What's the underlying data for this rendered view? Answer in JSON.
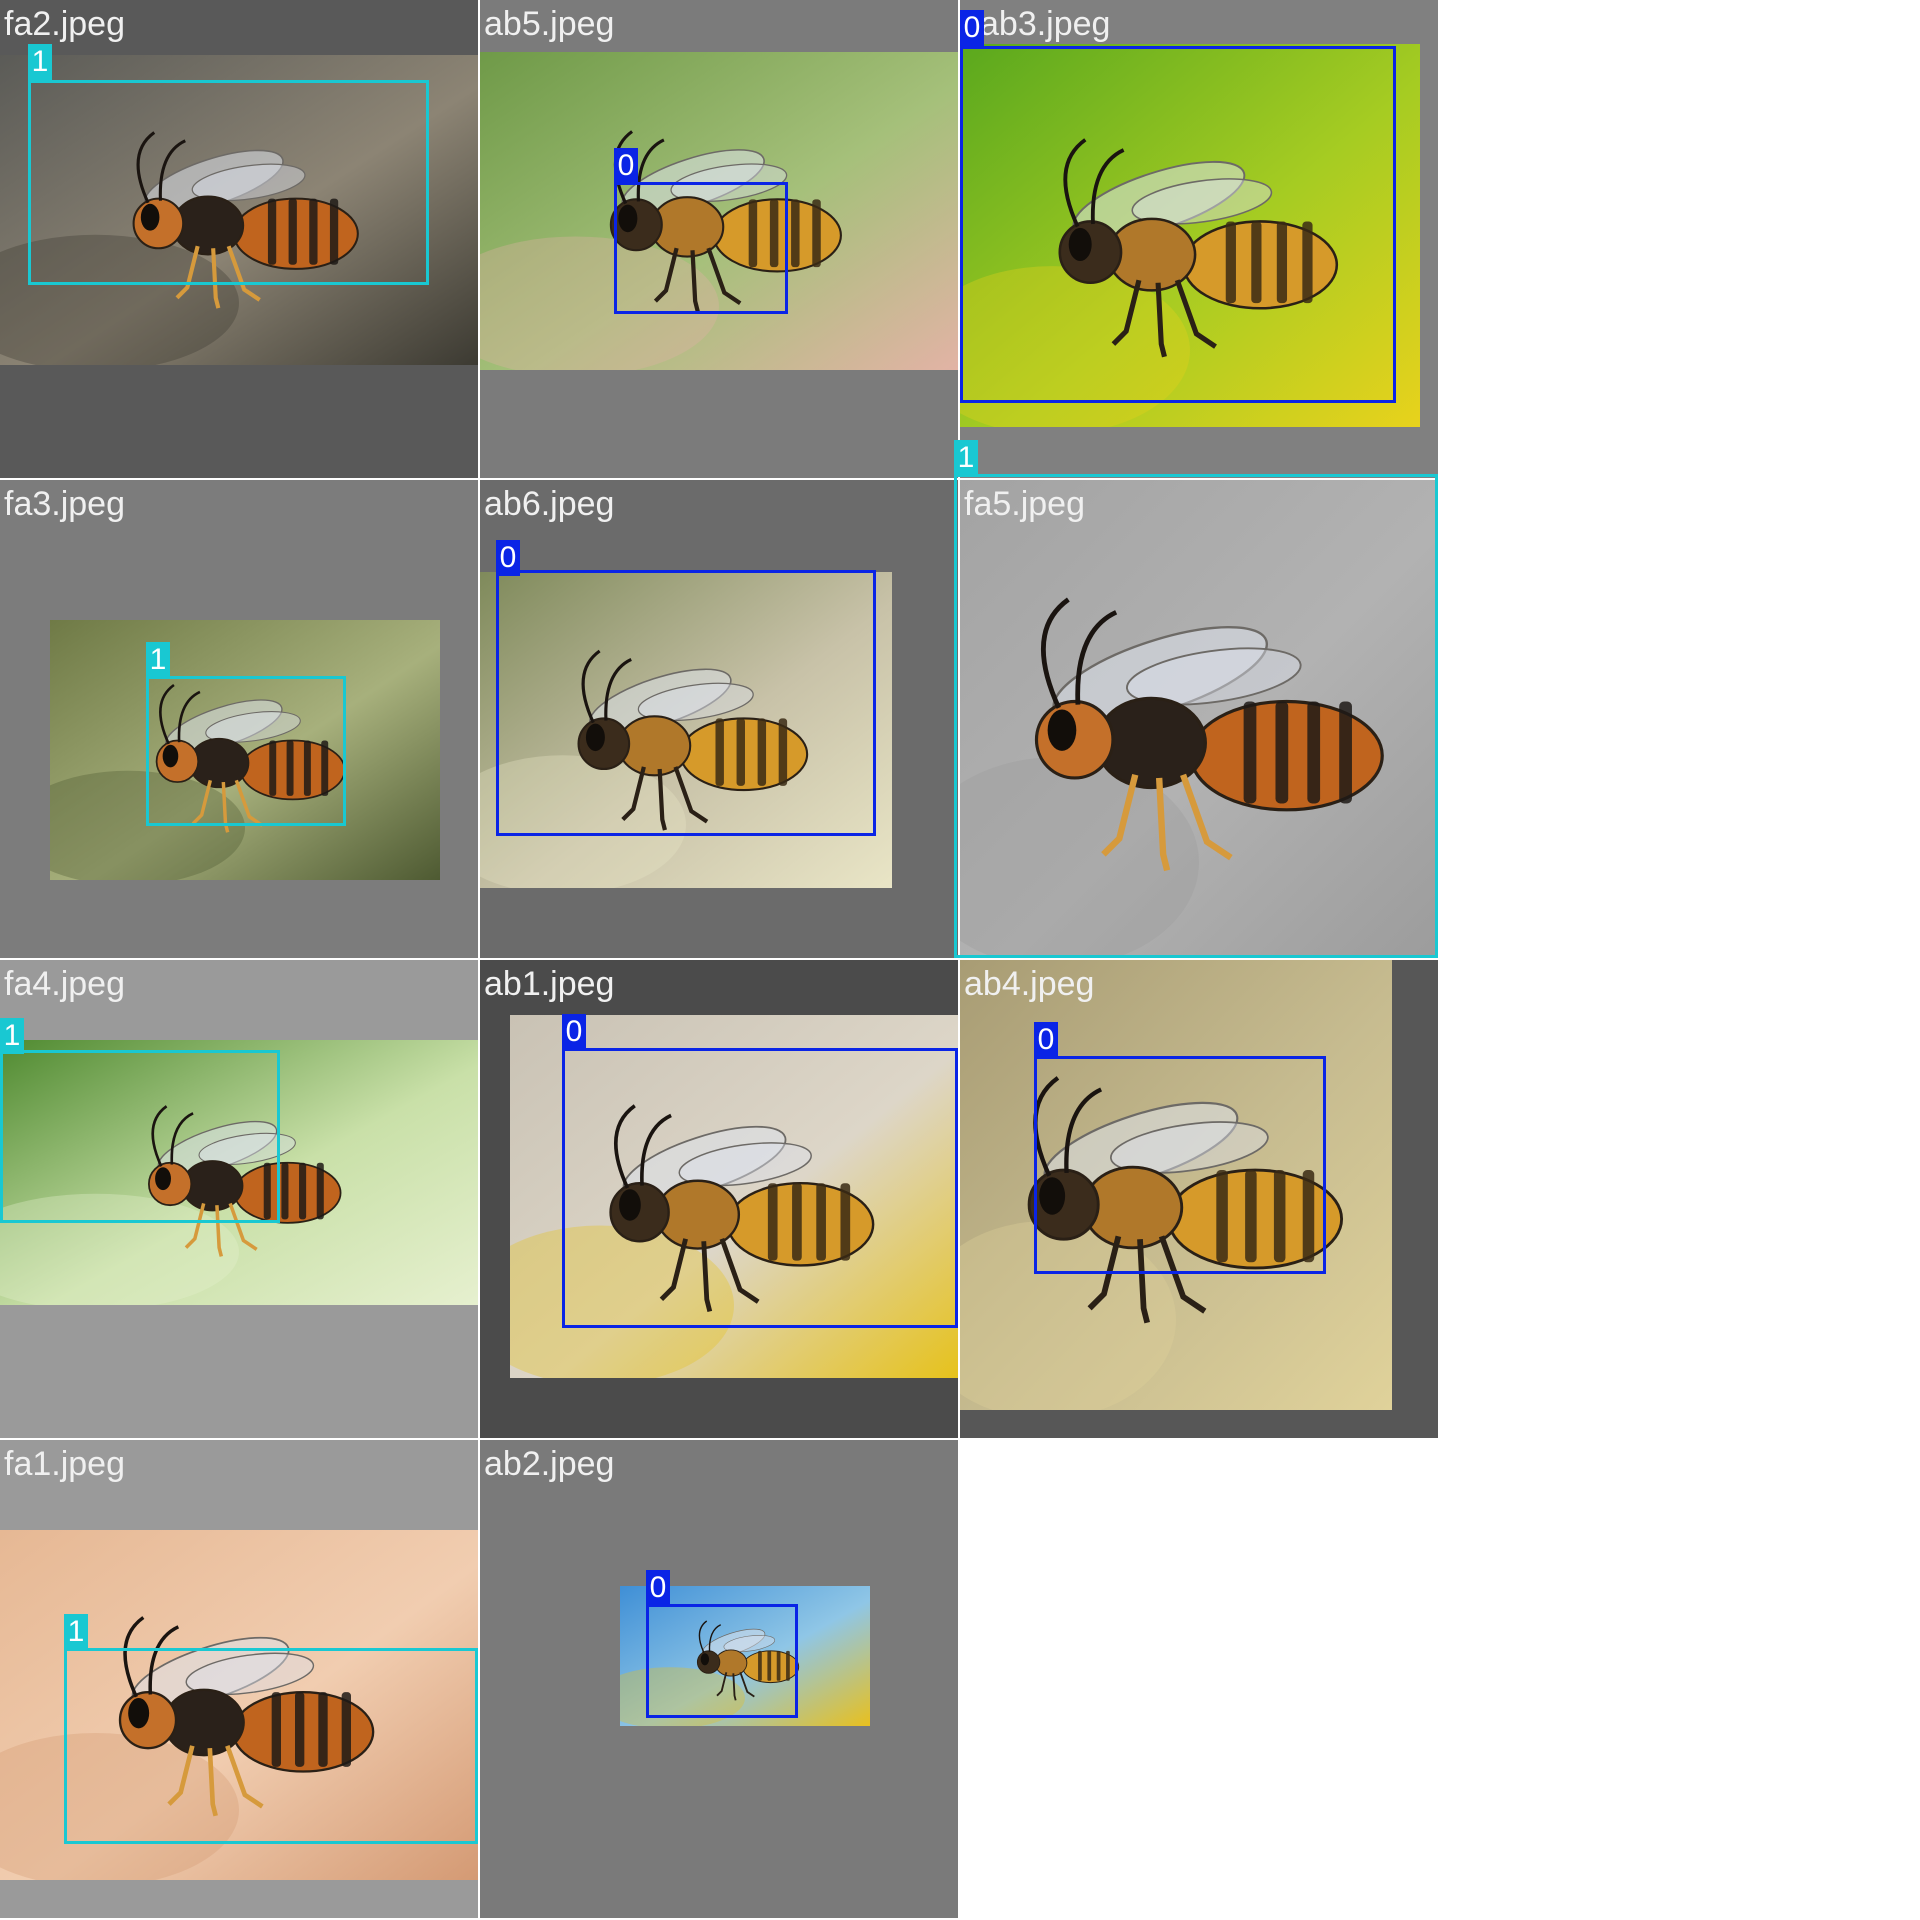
{
  "legend": {
    "class_colors": {
      "0": "#0a24e6",
      "1": "#19c8d2"
    }
  },
  "tiles": [
    {
      "filename": "fa2.jpeg",
      "subject": "hornet",
      "tile_bg": "#595959",
      "photo_colors": [
        "#5b5b57",
        "#8c8474",
        "#3c3a32"
      ],
      "detections": [
        {
          "class_label": "1",
          "class_color": "#19c8d2"
        }
      ]
    },
    {
      "filename": "ab5.jpeg",
      "subject": "honeybee",
      "tile_bg": "#7b7b7b",
      "photo_colors": [
        "#6f9a48",
        "#a5c07a",
        "#e2b3a5"
      ],
      "detections": [
        {
          "class_label": "0",
          "class_color": "#0a24e6"
        }
      ]
    },
    {
      "filename": "ab3.jpeg",
      "subject": "honeybee",
      "tile_bg": "#808080",
      "photo_colors": [
        "#5aa81e",
        "#a6cc22",
        "#e8d21c"
      ],
      "detections": [
        {
          "class_label": "0",
          "class_color": "#0a24e6"
        }
      ]
    },
    {
      "filename": "fa3.jpeg",
      "subject": "hornet",
      "tile_bg": "#7c7c7c",
      "photo_colors": [
        "#6f7a46",
        "#a7b07c",
        "#4e5a32"
      ],
      "detections": [
        {
          "class_label": "1",
          "class_color": "#19c8d2"
        }
      ]
    },
    {
      "filename": "ab6.jpeg",
      "subject": "honeybee",
      "tile_bg": "#6b6b6b",
      "photo_colors": [
        "#7f8a5b",
        "#c8c2a8",
        "#e9e5c6"
      ],
      "detections": [
        {
          "class_label": "0",
          "class_color": "#0a24e6"
        }
      ]
    },
    {
      "filename": "fa5.jpeg",
      "subject": "hornet",
      "tile_bg": "#9a9a9a",
      "photo_colors": [
        "#a3a3a3",
        "#b2b2b2",
        "#9c9c9c"
      ],
      "detections": [
        {
          "class_label": "1",
          "class_color": "#19c8d2"
        }
      ]
    },
    {
      "filename": "fa4.jpeg",
      "subject": "hornet",
      "tile_bg": "#9a9a9a",
      "photo_colors": [
        "#4f8a30",
        "#c9e0a8",
        "#e6f0cf"
      ],
      "detections": [
        {
          "class_label": "1",
          "class_color": "#19c8d2"
        }
      ]
    },
    {
      "filename": "ab1.jpeg",
      "subject": "honeybee",
      "tile_bg": "#4b4b4b",
      "photo_colors": [
        "#c9c2b4",
        "#ddd6c8",
        "#e6c21c"
      ],
      "detections": [
        {
          "class_label": "0",
          "class_color": "#0a24e6"
        }
      ]
    },
    {
      "filename": "ab4.jpeg",
      "subject": "honeybee",
      "tile_bg": "#575757",
      "photo_colors": [
        "#a89c74",
        "#c7bc90",
        "#e0d29a"
      ],
      "detections": [
        {
          "class_label": "0",
          "class_color": "#0a24e6"
        }
      ]
    },
    {
      "filename": "fa1.jpeg",
      "subject": "hornet",
      "tile_bg": "#9a9a9a",
      "photo_colors": [
        "#e6b894",
        "#f1cdb0",
        "#d49a74"
      ],
      "detections": [
        {
          "class_label": "1",
          "class_color": "#19c8d2"
        }
      ]
    },
    {
      "filename": "ab2.jpeg",
      "subject": "honeybee",
      "tile_bg": "#7a7a7a",
      "photo_colors": [
        "#3f8fd6",
        "#8fc6e6",
        "#e8c01e"
      ],
      "detections": [
        {
          "class_label": "0",
          "class_color": "#0a24e6"
        }
      ]
    }
  ]
}
